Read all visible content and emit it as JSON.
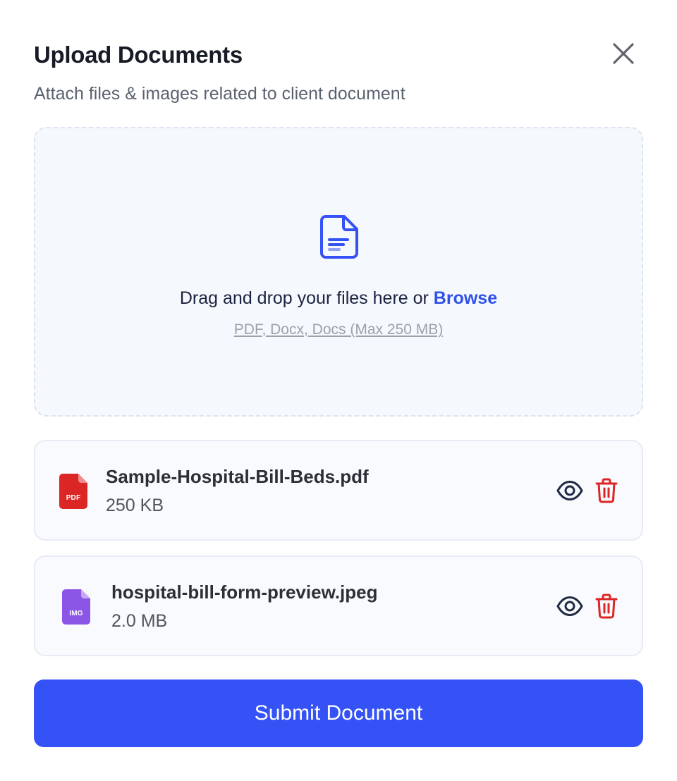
{
  "header": {
    "title": "Upload Documents",
    "subtitle": "Attach files & images related to client document"
  },
  "dropzone": {
    "prompt": "Drag and drop your files here or",
    "browse_label": "Browse",
    "hint": "PDF, Docx, Docs (Max 250 MB)",
    "icon": "document-icon"
  },
  "files": [
    {
      "name": "Sample-Hospital-Bill-Beds.pdf",
      "size": "250 KB",
      "type_label": "PDF",
      "icon": "pdf-file-icon",
      "color": "#dc2626"
    },
    {
      "name": "hospital-bill-form-preview.jpeg",
      "size": "2.0 MB",
      "type_label": "IMG",
      "icon": "image-file-icon",
      "color": "#8b55e6"
    }
  ],
  "actions": {
    "preview_icon": "eye-icon",
    "delete_icon": "trash-icon"
  },
  "submit": {
    "label": "Submit Document"
  },
  "colors": {
    "accent": "#3452f6",
    "danger": "#dc2626",
    "dropzone_bg": "#f5f8fd"
  }
}
